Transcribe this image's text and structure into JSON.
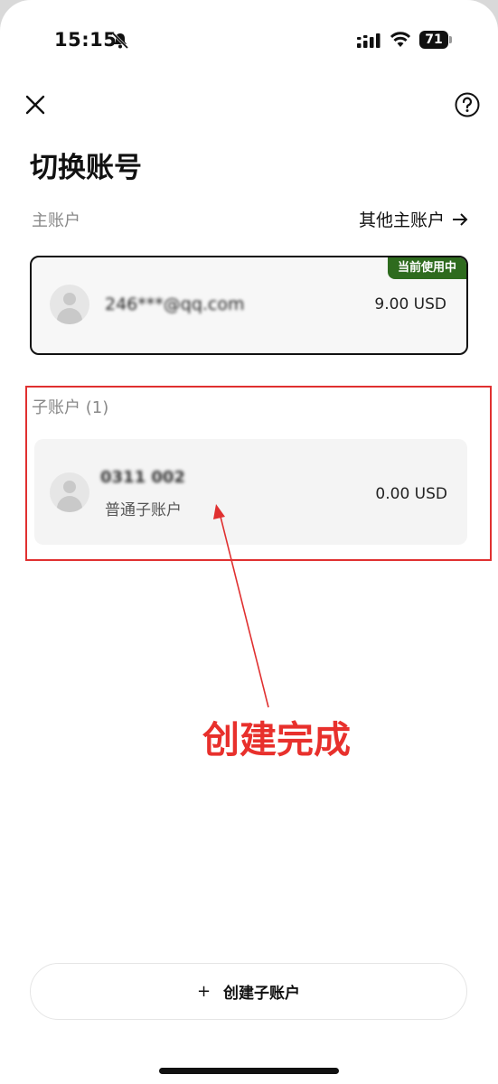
{
  "status_bar": {
    "time": "15:15",
    "battery": "71"
  },
  "header": {
    "title": "切换账号"
  },
  "main_account": {
    "section_label": "主账户",
    "other_accounts_label": "其他主账户",
    "badge": "当前使用中",
    "email": "246***@qq.com",
    "balance": "9.00 USD"
  },
  "sub_accounts": {
    "section_label": "子账户 (1)",
    "items": [
      {
        "name": "0311 002",
        "type": "普通子账户",
        "balance": "0.00 USD"
      }
    ]
  },
  "annotation": {
    "text": "创建完成",
    "color": "#e8302c"
  },
  "footer": {
    "create_button_label": "创建子账户"
  },
  "colors": {
    "badge": "#2e6b1e",
    "annotation": "#e03030"
  }
}
